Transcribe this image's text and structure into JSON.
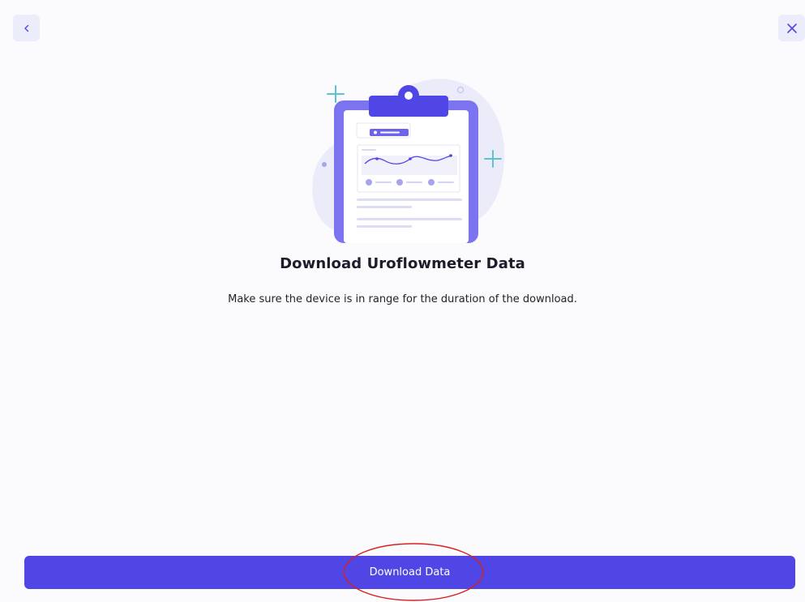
{
  "nav": {
    "back_icon": "chevron-left-icon",
    "close_icon": "close-icon"
  },
  "content": {
    "title": "Download Uroflowmeter Data",
    "subtitle": "Make sure the device is in range for the duration of the download."
  },
  "footer": {
    "download_label": "Download Data"
  },
  "colors": {
    "accent": "#4f46e5",
    "accent_light": "#ecedfb",
    "highlight": "#d9201f",
    "illustration_teal": "#59c4cf"
  }
}
